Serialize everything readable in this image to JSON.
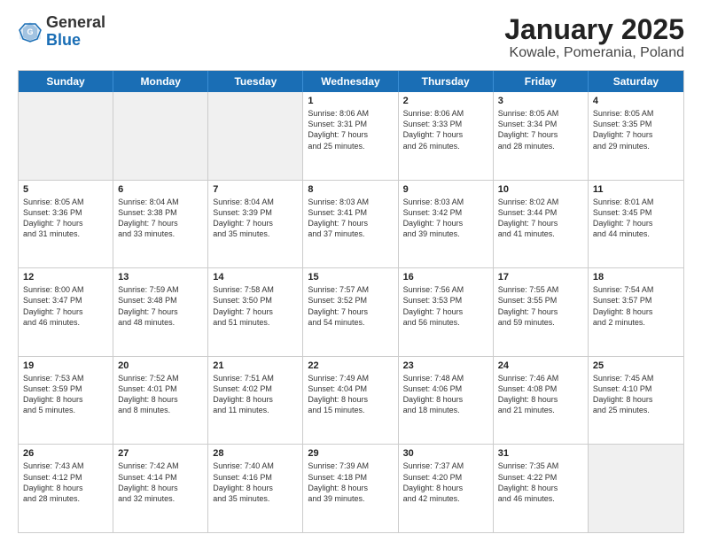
{
  "header": {
    "logo_general": "General",
    "logo_blue": "Blue",
    "title": "January 2025",
    "location": "Kowale, Pomerania, Poland"
  },
  "weekdays": [
    "Sunday",
    "Monday",
    "Tuesday",
    "Wednesday",
    "Thursday",
    "Friday",
    "Saturday"
  ],
  "rows": [
    [
      {
        "day": "",
        "info": "",
        "shaded": true
      },
      {
        "day": "",
        "info": "",
        "shaded": true
      },
      {
        "day": "",
        "info": "",
        "shaded": true
      },
      {
        "day": "1",
        "info": "Sunrise: 8:06 AM\nSunset: 3:31 PM\nDaylight: 7 hours\nand 25 minutes."
      },
      {
        "day": "2",
        "info": "Sunrise: 8:06 AM\nSunset: 3:33 PM\nDaylight: 7 hours\nand 26 minutes."
      },
      {
        "day": "3",
        "info": "Sunrise: 8:05 AM\nSunset: 3:34 PM\nDaylight: 7 hours\nand 28 minutes."
      },
      {
        "day": "4",
        "info": "Sunrise: 8:05 AM\nSunset: 3:35 PM\nDaylight: 7 hours\nand 29 minutes."
      }
    ],
    [
      {
        "day": "5",
        "info": "Sunrise: 8:05 AM\nSunset: 3:36 PM\nDaylight: 7 hours\nand 31 minutes."
      },
      {
        "day": "6",
        "info": "Sunrise: 8:04 AM\nSunset: 3:38 PM\nDaylight: 7 hours\nand 33 minutes."
      },
      {
        "day": "7",
        "info": "Sunrise: 8:04 AM\nSunset: 3:39 PM\nDaylight: 7 hours\nand 35 minutes."
      },
      {
        "day": "8",
        "info": "Sunrise: 8:03 AM\nSunset: 3:41 PM\nDaylight: 7 hours\nand 37 minutes."
      },
      {
        "day": "9",
        "info": "Sunrise: 8:03 AM\nSunset: 3:42 PM\nDaylight: 7 hours\nand 39 minutes."
      },
      {
        "day": "10",
        "info": "Sunrise: 8:02 AM\nSunset: 3:44 PM\nDaylight: 7 hours\nand 41 minutes."
      },
      {
        "day": "11",
        "info": "Sunrise: 8:01 AM\nSunset: 3:45 PM\nDaylight: 7 hours\nand 44 minutes."
      }
    ],
    [
      {
        "day": "12",
        "info": "Sunrise: 8:00 AM\nSunset: 3:47 PM\nDaylight: 7 hours\nand 46 minutes."
      },
      {
        "day": "13",
        "info": "Sunrise: 7:59 AM\nSunset: 3:48 PM\nDaylight: 7 hours\nand 48 minutes."
      },
      {
        "day": "14",
        "info": "Sunrise: 7:58 AM\nSunset: 3:50 PM\nDaylight: 7 hours\nand 51 minutes."
      },
      {
        "day": "15",
        "info": "Sunrise: 7:57 AM\nSunset: 3:52 PM\nDaylight: 7 hours\nand 54 minutes."
      },
      {
        "day": "16",
        "info": "Sunrise: 7:56 AM\nSunset: 3:53 PM\nDaylight: 7 hours\nand 56 minutes."
      },
      {
        "day": "17",
        "info": "Sunrise: 7:55 AM\nSunset: 3:55 PM\nDaylight: 7 hours\nand 59 minutes."
      },
      {
        "day": "18",
        "info": "Sunrise: 7:54 AM\nSunset: 3:57 PM\nDaylight: 8 hours\nand 2 minutes."
      }
    ],
    [
      {
        "day": "19",
        "info": "Sunrise: 7:53 AM\nSunset: 3:59 PM\nDaylight: 8 hours\nand 5 minutes."
      },
      {
        "day": "20",
        "info": "Sunrise: 7:52 AM\nSunset: 4:01 PM\nDaylight: 8 hours\nand 8 minutes."
      },
      {
        "day": "21",
        "info": "Sunrise: 7:51 AM\nSunset: 4:02 PM\nDaylight: 8 hours\nand 11 minutes."
      },
      {
        "day": "22",
        "info": "Sunrise: 7:49 AM\nSunset: 4:04 PM\nDaylight: 8 hours\nand 15 minutes."
      },
      {
        "day": "23",
        "info": "Sunrise: 7:48 AM\nSunset: 4:06 PM\nDaylight: 8 hours\nand 18 minutes."
      },
      {
        "day": "24",
        "info": "Sunrise: 7:46 AM\nSunset: 4:08 PM\nDaylight: 8 hours\nand 21 minutes."
      },
      {
        "day": "25",
        "info": "Sunrise: 7:45 AM\nSunset: 4:10 PM\nDaylight: 8 hours\nand 25 minutes."
      }
    ],
    [
      {
        "day": "26",
        "info": "Sunrise: 7:43 AM\nSunset: 4:12 PM\nDaylight: 8 hours\nand 28 minutes."
      },
      {
        "day": "27",
        "info": "Sunrise: 7:42 AM\nSunset: 4:14 PM\nDaylight: 8 hours\nand 32 minutes."
      },
      {
        "day": "28",
        "info": "Sunrise: 7:40 AM\nSunset: 4:16 PM\nDaylight: 8 hours\nand 35 minutes."
      },
      {
        "day": "29",
        "info": "Sunrise: 7:39 AM\nSunset: 4:18 PM\nDaylight: 8 hours\nand 39 minutes."
      },
      {
        "day": "30",
        "info": "Sunrise: 7:37 AM\nSunset: 4:20 PM\nDaylight: 8 hours\nand 42 minutes."
      },
      {
        "day": "31",
        "info": "Sunrise: 7:35 AM\nSunset: 4:22 PM\nDaylight: 8 hours\nand 46 minutes."
      },
      {
        "day": "",
        "info": "",
        "shaded": true
      }
    ]
  ]
}
